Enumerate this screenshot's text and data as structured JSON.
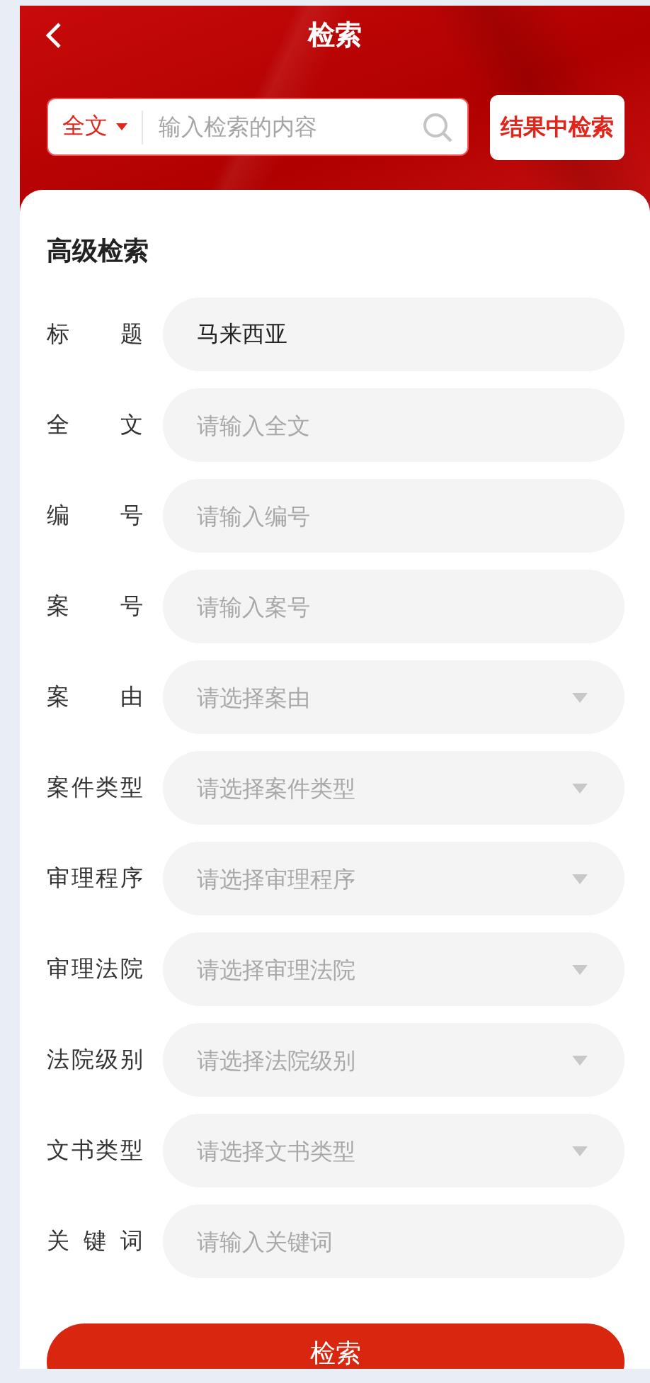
{
  "header": {
    "title": "检索"
  },
  "search": {
    "scope": "全文",
    "placeholder": "输入检索的内容",
    "within_button": "结果中检索"
  },
  "advanced": {
    "title": "高级检索",
    "fields": [
      {
        "label": "标题",
        "kind": "input",
        "value": "马来西亚"
      },
      {
        "label": "全文",
        "kind": "input",
        "placeholder": "请输入全文"
      },
      {
        "label": "编号",
        "kind": "input",
        "placeholder": "请输入编号"
      },
      {
        "label": "案号",
        "kind": "input",
        "placeholder": "请输入案号"
      },
      {
        "label": "案由",
        "kind": "select",
        "placeholder": "请选择案由"
      },
      {
        "label": "案件类型",
        "kind": "select",
        "placeholder": "请选择案件类型"
      },
      {
        "label": "审理程序",
        "kind": "select",
        "placeholder": "请选择审理程序"
      },
      {
        "label": "审理法院",
        "kind": "select",
        "placeholder": "请选择审理法院"
      },
      {
        "label": "法院级别",
        "kind": "select",
        "placeholder": "请选择法院级别"
      },
      {
        "label": "文书类型",
        "kind": "select",
        "placeholder": "请选择文书类型"
      },
      {
        "label": "关键词",
        "kind": "input",
        "placeholder": "请输入关键词"
      }
    ]
  },
  "submit": "检索"
}
